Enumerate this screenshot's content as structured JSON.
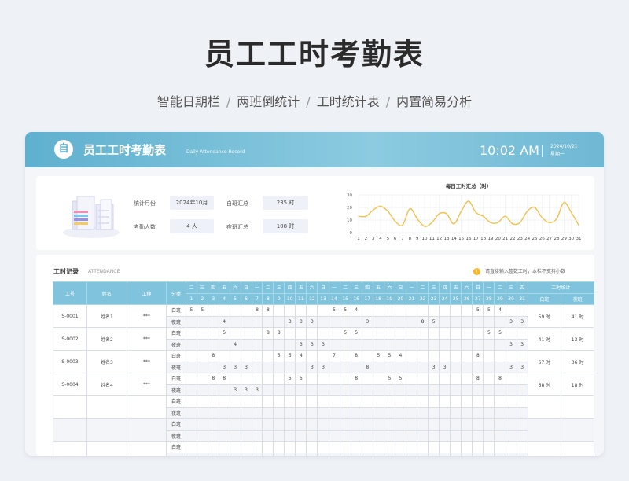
{
  "page": {
    "title": "员工工时考勤表",
    "subtitle": [
      "智能日期栏",
      "两班倒统计",
      "工时统计表",
      "内置简易分析"
    ],
    "separator": "/"
  },
  "header": {
    "logo": "自",
    "title": "员工工时考勤表",
    "subtitle": "Daily Attendance Record",
    "time": "10:02 AM",
    "date": "2024/10/21",
    "weekday": "星期一"
  },
  "stats": {
    "month_label": "统计月份",
    "month_value": "2024年10月",
    "day_total_label": "白班汇总",
    "day_total_value": "235 时",
    "people_label": "考勤人数",
    "people_value": "4 人",
    "night_total_label": "夜班汇总",
    "night_total_value": "108 时"
  },
  "chart_data": {
    "type": "line",
    "title": "每日工时汇总（时）",
    "x": [
      1,
      2,
      3,
      4,
      5,
      6,
      7,
      8,
      9,
      10,
      11,
      12,
      13,
      14,
      15,
      16,
      17,
      18,
      19,
      20,
      21,
      22,
      23,
      24,
      25,
      26,
      27,
      28,
      29,
      30,
      31
    ],
    "y": [
      13,
      13,
      18,
      21,
      17,
      9,
      6,
      19,
      11,
      5,
      8,
      15,
      15,
      7,
      17,
      25,
      16,
      13,
      8,
      8,
      13,
      7,
      8,
      17,
      20,
      12,
      8,
      11,
      24,
      16,
      6
    ],
    "ylim": [
      0,
      30
    ],
    "yticks": [
      0,
      10,
      20,
      30
    ],
    "color": "#f2c14e",
    "grid": true
  },
  "records": {
    "title": "工时记录",
    "subtitle": "ATTENDANCE",
    "note_icon": "!",
    "note": "请直接输入整数工时，本栏不支持小数",
    "headers": {
      "id": "工号",
      "name": "姓名",
      "type": "工种",
      "shift": "分类",
      "stats": "工时统计",
      "day": "白班",
      "night": "夜班"
    },
    "weekdays": [
      "二",
      "三",
      "四",
      "五",
      "六",
      "日",
      "一",
      "二",
      "三",
      "四",
      "五",
      "六",
      "日",
      "一",
      "二",
      "三",
      "四",
      "五",
      "六",
      "日",
      "一",
      "二",
      "三",
      "四",
      "五",
      "六",
      "日",
      "一",
      "二",
      "三",
      "四"
    ],
    "dates": [
      "1",
      "2",
      "3",
      "4",
      "5",
      "6",
      "7",
      "8",
      "9",
      "10",
      "11",
      "12",
      "13",
      "14",
      "15",
      "16",
      "17",
      "18",
      "19",
      "20",
      "21",
      "22",
      "23",
      "24",
      "25",
      "26",
      "27",
      "28",
      "29",
      "30",
      "31"
    ],
    "shift_labels": [
      "白班",
      "夜班"
    ],
    "employees": [
      {
        "id": "S-0001",
        "name": "姓名1",
        "type": "***",
        "day": [
          "5",
          "5",
          "",
          "",
          "",
          "",
          "8",
          "8",
          "",
          "",
          "",
          "",
          "",
          "5",
          "5",
          "4",
          "",
          "",
          "",
          "",
          "",
          "",
          "",
          "",
          "",
          "",
          "5",
          "5",
          "4",
          "",
          ""
        ],
        "night": [
          "",
          "",
          "",
          "4",
          "",
          "",
          "",
          "",
          "",
          "3",
          "3",
          "3",
          "",
          "",
          "",
          "",
          "3",
          "",
          "",
          "",
          "",
          "8",
          "5",
          "",
          "",
          "",
          "",
          "",
          "",
          "3",
          "3"
        ],
        "day_total": "59 时",
        "night_total": "41 时"
      },
      {
        "id": "S-0002",
        "name": "姓名2",
        "type": "***",
        "day": [
          "",
          "",
          "",
          "5",
          "",
          "",
          "",
          "8",
          "8",
          "",
          "",
          "",
          "",
          "",
          "5",
          "5",
          "",
          "",
          "",
          "",
          "",
          "",
          "",
          "",
          "",
          "",
          "",
          "5",
          "5",
          "",
          ""
        ],
        "night": [
          "",
          "",
          "",
          "",
          "4",
          "",
          "",
          "",
          "",
          "",
          "3",
          "3",
          "3",
          "",
          "",
          "",
          "",
          "",
          "",
          "",
          "",
          "",
          "",
          "",
          "",
          "",
          "",
          "",
          "",
          "3",
          "3"
        ],
        "day_total": "41 时",
        "night_total": "13 时"
      },
      {
        "id": "S-0003",
        "name": "姓名3",
        "type": "***",
        "day": [
          "",
          "",
          "8",
          "",
          "",
          "",
          "",
          "",
          "5",
          "5",
          "4",
          "",
          "",
          "7",
          "",
          "8",
          "",
          "5",
          "5",
          "4",
          "",
          "",
          "",
          "",
          "",
          "",
          "8",
          "",
          "",
          "",
          ""
        ],
        "night": [
          "",
          "",
          "",
          "3",
          "3",
          "3",
          "",
          "",
          "",
          "",
          "",
          "3",
          "3",
          "",
          "",
          "",
          "8",
          "",
          "",
          "",
          "",
          "",
          "3",
          "3",
          "",
          "",
          "",
          "",
          "",
          "3",
          "3"
        ],
        "day_total": "67 时",
        "night_total": "36 时"
      },
      {
        "id": "S-0004",
        "name": "姓名4",
        "type": "***",
        "day": [
          "",
          "",
          "8",
          "8",
          "",
          "",
          "",
          "",
          "",
          "5",
          "5",
          "",
          "",
          "",
          "",
          "8",
          "",
          "",
          "5",
          "5",
          "",
          "",
          "",
          "",
          "",
          "",
          "8",
          "",
          "8",
          "",
          ""
        ],
        "night": [
          "",
          "",
          "",
          "",
          "3",
          "3",
          "3",
          "",
          "",
          "",
          "",
          "",
          "",
          "",
          "",
          "",
          "",
          "",
          "",
          "",
          "",
          "",
          "",
          "",
          "",
          "",
          "",
          "",
          "",
          "",
          ""
        ],
        "day_total": "68 时",
        "night_total": "18 时"
      }
    ],
    "empty_rows": 3
  },
  "colors": {
    "accent": "#7fc4dc",
    "header_band": "#5fb0cf",
    "chart_line": "#f2c14e",
    "note_dot": "#f5b72c"
  }
}
